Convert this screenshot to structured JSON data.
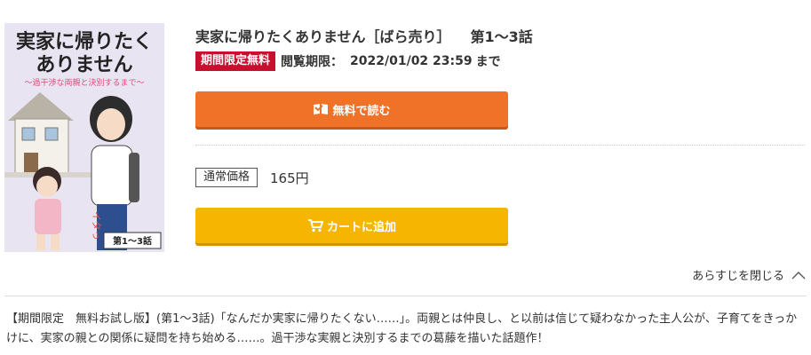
{
  "cover": {
    "title_line1": "実家に帰りたく",
    "title_line2": "ありません",
    "subtitle": "〜過干渉な両親と決別するまで〜",
    "episode_tag": "第1〜3話",
    "author_mark": "イタっ"
  },
  "book": {
    "title": "実家に帰りたくありません［ばら売り］",
    "episodes": "第1〜3話"
  },
  "promo": {
    "badge": "期間限定無料",
    "period_label": "閲覧期限：",
    "period_date": "2022/01/02 23:59",
    "period_suffix": "まで"
  },
  "actions": {
    "read_free_label": "無料で読む",
    "add_cart_label": "カートに追加"
  },
  "price": {
    "label": "通常価格",
    "value": "165円"
  },
  "synopsis": {
    "toggle_label": "あらすじを閉じる",
    "text": "【期間限定　無料お試し版】(第1〜3話)「なんだか実家に帰りたくない……」。両親とは仲良し、と以前は信じて疑わなかった主人公が、子育てをきっかけに、実家の親との関係に疑問を持ち始める……。過干渉な実親と決別するまでの葛藤を描いた話題作！"
  },
  "colors": {
    "read_button": "#f07229",
    "cart_button": "#f6b500",
    "badge": "#c8102e"
  },
  "icons": {
    "read": "book-icon",
    "cart": "cart-icon",
    "toggle": "chevron-up-icon"
  }
}
